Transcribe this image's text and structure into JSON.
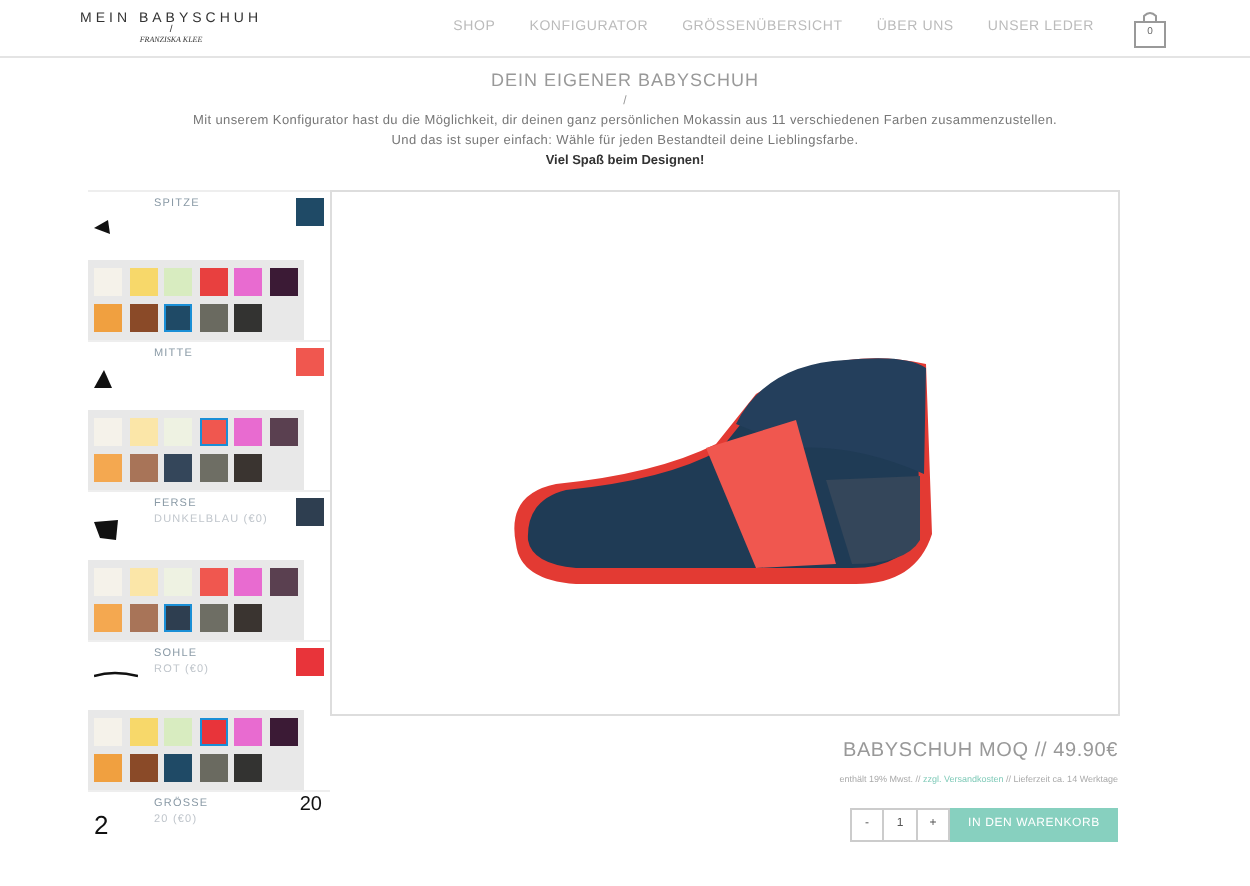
{
  "brand": {
    "name": "MEIN BABYSCHUH",
    "separator": "/",
    "signature": "FRANZISKA KLEE"
  },
  "nav": [
    {
      "label": "SHOP"
    },
    {
      "label": "KONFIGURATOR"
    },
    {
      "label": "GRÖSSENÜBERSICHT"
    },
    {
      "label": "ÜBER UNS"
    },
    {
      "label": "UNSER LEDER"
    }
  ],
  "cart": {
    "count": "0"
  },
  "intro": {
    "title": "DEIN EIGENER BABYSCHUH",
    "separator": "/",
    "lines": [
      "Mit unserem Konfigurator hast du die Möglichkeit, dir deinen ganz persönlichen Mokassin aus 11 verschiedenen Farben zusammenzustellen.",
      "Und das ist super einfach: Wähle für jeden Bestandteil deine Lieblingsfarbe."
    ],
    "emphasis": "Viel Spaß beim Designen!"
  },
  "parts": [
    {
      "kind": "tip",
      "name": "SPITZE",
      "color": "#1f4a66",
      "swatches": [
        {
          "color": "#f5f2ea",
          "selected": false
        },
        {
          "color": "#f7d86a",
          "selected": false
        },
        {
          "color": "#d8ecc0",
          "selected": false
        },
        {
          "color": "#e8403f",
          "selected": false
        },
        {
          "color": "#e86bd0",
          "selected": false
        },
        {
          "color": "#3b1a35",
          "selected": false
        },
        {
          "color": "#f0a040",
          "selected": false
        },
        {
          "color": "#8a4a28",
          "selected": false
        },
        {
          "color": "#1f4a66",
          "selected": true
        },
        {
          "color": "#6a6a60",
          "selected": false
        },
        {
          "color": "#333331",
          "selected": false
        }
      ]
    },
    {
      "kind": "middle",
      "name": "MITTE",
      "color": "#f0574f",
      "swatches": [
        {
          "color": "#f5f2ea",
          "selected": false
        },
        {
          "color": "#fbe6a8",
          "selected": false
        },
        {
          "color": "#eef2e2",
          "selected": false
        },
        {
          "color": "#f0574f",
          "selected": true
        },
        {
          "color": "#e86bd0",
          "selected": false
        },
        {
          "color": "#5a4050",
          "selected": false
        },
        {
          "color": "#f4a850",
          "selected": false
        },
        {
          "color": "#a87458",
          "selected": false
        },
        {
          "color": "#34465a",
          "selected": false
        },
        {
          "color": "#6e6e64",
          "selected": false
        },
        {
          "color": "#3a3430",
          "selected": false
        }
      ]
    },
    {
      "kind": "heel",
      "name": "FERSE",
      "detail": "DUNKELBLAU (€0)",
      "color": "#2e3e50",
      "swatches": [
        {
          "color": "#f5f2ea",
          "selected": false
        },
        {
          "color": "#fbe6a8",
          "selected": false
        },
        {
          "color": "#eef2e2",
          "selected": false
        },
        {
          "color": "#f0574f",
          "selected": false
        },
        {
          "color": "#e86bd0",
          "selected": false
        },
        {
          "color": "#5a4050",
          "selected": false
        },
        {
          "color": "#f4a850",
          "selected": false
        },
        {
          "color": "#a87458",
          "selected": false
        },
        {
          "color": "#2e3e50",
          "selected": true
        },
        {
          "color": "#6e6e64",
          "selected": false
        },
        {
          "color": "#3a3430",
          "selected": false
        }
      ]
    },
    {
      "kind": "sole",
      "name": "SOHLE",
      "detail": "ROT (€0)",
      "color": "#e8343a",
      "swatches": [
        {
          "color": "#f5f2ea",
          "selected": false
        },
        {
          "color": "#f7d86a",
          "selected": false
        },
        {
          "color": "#d8ecc0",
          "selected": false
        },
        {
          "color": "#e8343a",
          "selected": true
        },
        {
          "color": "#e86bd0",
          "selected": false
        },
        {
          "color": "#3b1a35",
          "selected": false
        },
        {
          "color": "#f0a040",
          "selected": false
        },
        {
          "color": "#8a4a28",
          "selected": false
        },
        {
          "color": "#1f4a66",
          "selected": false
        },
        {
          "color": "#6a6a60",
          "selected": false
        },
        {
          "color": "#333331",
          "selected": false
        }
      ]
    },
    {
      "kind": "size",
      "name": "GRÖSSE",
      "detail": "20 (€0)",
      "icon": "2",
      "value": "20"
    }
  ],
  "product": {
    "name": "BABYSCHUH MOQ // 49.90€",
    "note": "enthält 19% Mwst. // ",
    "link": "zzgl. Versandkosten",
    "note_end": " // Lieferzeit ca. 14 Werktage"
  },
  "order": {
    "minus": "-",
    "quantity": "1",
    "plus": "+",
    "button": "IN DEN WARENKORB"
  }
}
